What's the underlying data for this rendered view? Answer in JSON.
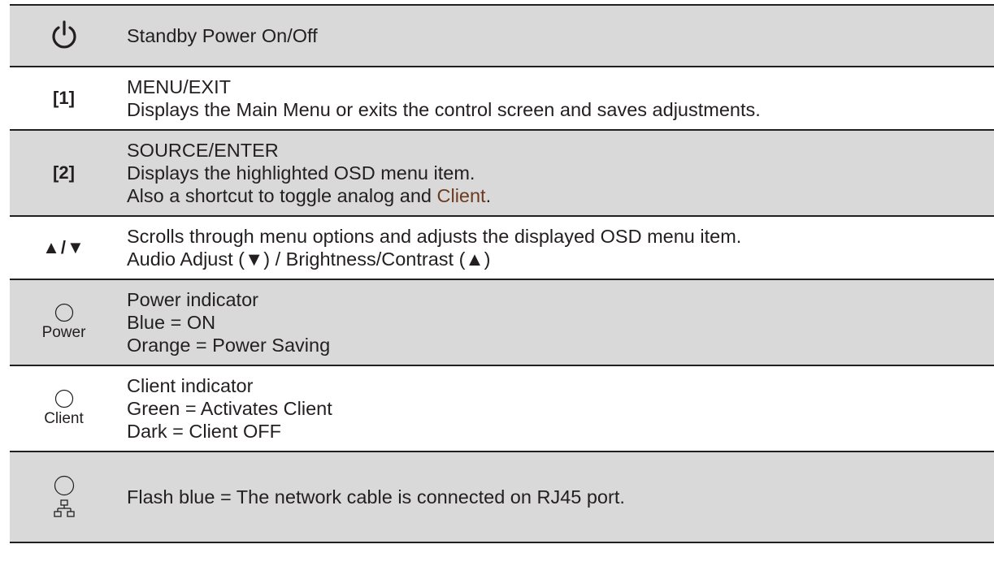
{
  "rows": [
    {
      "symbol_icon": "power-button-icon",
      "lines": [
        "Standby Power On/Off"
      ]
    },
    {
      "symbol_text": "[1]",
      "lines": [
        "MENU/EXIT",
        "Displays the Main Menu or exits the control screen and saves adjustments."
      ]
    },
    {
      "symbol_text": "[2]",
      "lines": [
        "SOURCE/ENTER",
        "Displays the highlighted OSD menu item."
      ],
      "line3_prefix": "Also a shortcut to toggle analog and ",
      "line3_highlight": "Client",
      "line3_suffix": "."
    },
    {
      "symbol_text": "▲/▼",
      "lines": [
        "Scrolls through menu options and adjusts the displayed OSD menu item.",
        "Audio Adjust (▼) / Brightness/Contrast (▲)"
      ]
    },
    {
      "symbol_icon": "indicator-circle-icon",
      "symbol_label": "Power",
      "lines": [
        "Power indicator",
        "Blue = ON",
        "Orange = Power Saving"
      ]
    },
    {
      "symbol_icon": "indicator-circle-icon",
      "symbol_label": "Client",
      "lines": [
        "Client indicator",
        "Green = Activates Client",
        "Dark = Client OFF"
      ]
    },
    {
      "symbol_icon": "network-icon",
      "lines": [
        "Flash blue = The network cable is connected on RJ45 port."
      ]
    }
  ],
  "colors": {
    "shaded_row": "#d9d9d9",
    "text": "#231f20",
    "highlight_text": "#6b3a1f"
  }
}
